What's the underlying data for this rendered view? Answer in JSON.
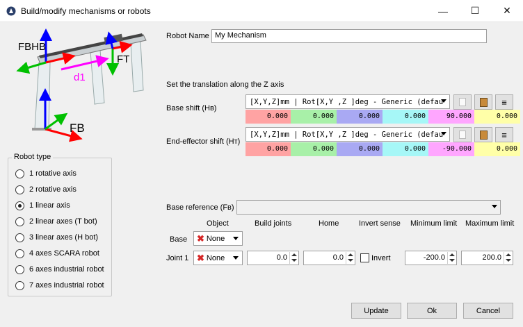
{
  "window": {
    "title": "Build/modify mechanisms or robots",
    "minimize_glyph": "—",
    "maximize_glyph": "☐",
    "close_glyph": "✕"
  },
  "diagram": {
    "label_fb_hb": "FBHB",
    "label_ft": "FT",
    "label_d1": "d1",
    "label_fb": "FB"
  },
  "robot_name": {
    "label": "Robot Name",
    "value": "My Mechanism"
  },
  "hint": "Set the translation along the Z axis",
  "base_shift": {
    "label": "Base shift (Hʙ)",
    "format": "[X,Y,Z]mm | Rot[X,Y ,Z  ]deg - Generic (defau",
    "values": [
      "0.000",
      "0.000",
      "0.000",
      "0.000",
      "90.000",
      "0.000"
    ]
  },
  "effector_shift": {
    "label": "End-effector shift (Hт)",
    "format": "[X,Y,Z]mm | Rot[X,Y ,Z  ]deg - Generic (defau",
    "values": [
      "0.000",
      "0.000",
      "0.000",
      "0.000",
      "-90.000",
      "0.000"
    ]
  },
  "robot_type": {
    "title": "Robot type",
    "options": [
      {
        "label": "1 rotative axis",
        "selected": false
      },
      {
        "label": "2 rotative axis",
        "selected": false
      },
      {
        "label": "1 linear axis",
        "selected": true
      },
      {
        "label": "2 linear axes (T bot)",
        "selected": false
      },
      {
        "label": "3 linear axes (H bot)",
        "selected": false
      },
      {
        "label": "4 axes SCARA robot",
        "selected": false
      },
      {
        "label": "6 axes industrial robot",
        "selected": false
      },
      {
        "label": "7 axes industrial robot",
        "selected": false
      }
    ]
  },
  "base_reference": {
    "label": "Base reference (Fʙ)",
    "value": ""
  },
  "columns": {
    "object": "Object",
    "build_joints": "Build joints",
    "home": "Home",
    "invert_sense": "Invert sense",
    "min_limit": "Minimum limit",
    "max_limit": "Maximum limit"
  },
  "rows": {
    "base_label": "Base",
    "base_object": "None",
    "joint1_label": "Joint 1",
    "joint1_object": "None",
    "joint1_build": "0.0",
    "joint1_home": "0.0",
    "joint1_invert_label": "Invert",
    "joint1_min": "-200.0",
    "joint1_max": "200.0"
  },
  "buttons": {
    "update": "Update",
    "ok": "Ok",
    "cancel": "Cancel"
  },
  "colors": {
    "x_axis": "#ff0000",
    "y_axis": "#00c000",
    "z_axis": "#0000ff",
    "d1": "#ff00ff"
  }
}
